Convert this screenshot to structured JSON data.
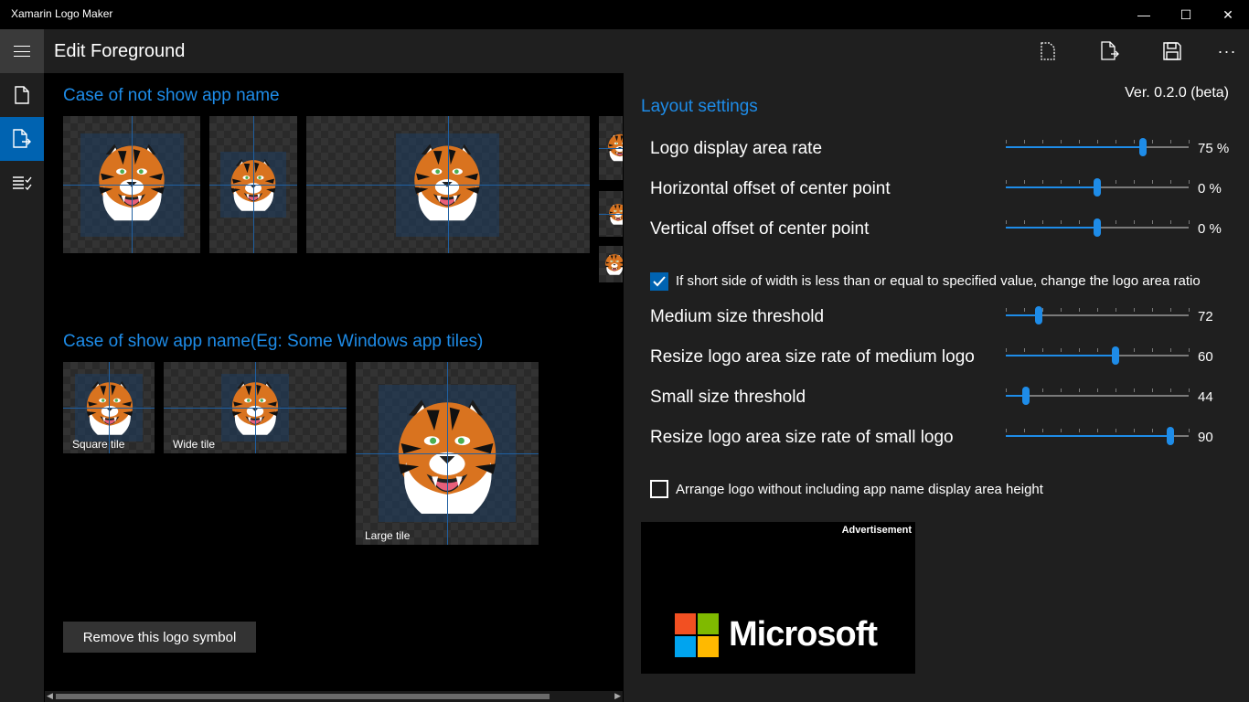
{
  "window": {
    "title": "Xamarin Logo Maker",
    "minimize_glyph": "—",
    "maximize_glyph": "☐",
    "close_glyph": "✕"
  },
  "header": {
    "title": "Edit Foreground",
    "more_glyph": "···"
  },
  "sidebar": {
    "items": [
      {
        "icon": "document-icon",
        "selected": false
      },
      {
        "icon": "export-document-icon",
        "selected": true
      },
      {
        "icon": "checklist-icon",
        "selected": false
      }
    ]
  },
  "left": {
    "section1_title": "Case of not show app name",
    "section2_title": "Case of show app name(Eg: Some Windows app tiles)",
    "tiles": {
      "square": "Square tile",
      "wide": "Wide tile",
      "large": "Large tile"
    },
    "remove_button": "Remove this logo symbol"
  },
  "settings": {
    "title": "Layout settings",
    "version": "Ver. 0.2.0 (beta)",
    "sliders": [
      {
        "label": "Logo display area rate",
        "value": 75,
        "display": "75 %",
        "min": 0,
        "max": 100
      },
      {
        "label": "Horizontal offset of center point",
        "value": 0,
        "display": "0 %",
        "min": -100,
        "max": 100
      },
      {
        "label": "Vertical offset of center point",
        "value": 0,
        "display": "0 %",
        "min": -100,
        "max": 100
      },
      {
        "label": "Medium size threshold",
        "value": 72,
        "display": "72",
        "min": 0,
        "max": 400
      },
      {
        "label": "Resize logo area size rate of medium logo",
        "value": 60,
        "display": "60",
        "min": 0,
        "max": 100
      },
      {
        "label": "Small size threshold",
        "value": 44,
        "display": "44",
        "min": 0,
        "max": 400
      },
      {
        "label": "Resize logo area size rate of small logo",
        "value": 90,
        "display": "90",
        "min": 0,
        "max": 100
      }
    ],
    "change_ratio_checkbox": {
      "label": "If short side of width is less than or equal to specified value, change the logo area ratio",
      "checked": true
    },
    "arrange_checkbox": {
      "label": "Arrange logo without including app name display area height",
      "checked": false
    }
  },
  "ad": {
    "label": "Advertisement",
    "brand": "Microsoft",
    "colors": {
      "red": "#f25022",
      "green": "#7fba00",
      "blue": "#00a4ef",
      "yellow": "#ffb900"
    }
  },
  "colors": {
    "accent": "#1e8ce8",
    "selected_nav": "#0063b1"
  }
}
